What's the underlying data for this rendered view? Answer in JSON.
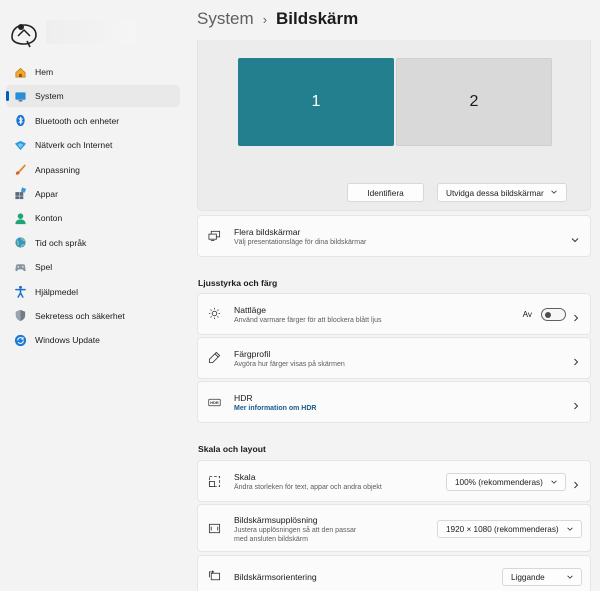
{
  "breadcrumb": {
    "parent": "System",
    "separator": "›",
    "current": "Bildskärm"
  },
  "sidebar": {
    "items": [
      {
        "label": "Hem",
        "icon": "home-icon",
        "active": false
      },
      {
        "label": "System",
        "icon": "system-icon",
        "active": true
      },
      {
        "label": "Bluetooth och enheter",
        "icon": "bluetooth-icon",
        "active": false
      },
      {
        "label": "Nätverk och Internet",
        "icon": "network-icon",
        "active": false
      },
      {
        "label": "Anpassning",
        "icon": "brush-icon",
        "active": false
      },
      {
        "label": "Appar",
        "icon": "apps-icon",
        "active": false
      },
      {
        "label": "Konton",
        "icon": "account-icon",
        "active": false
      },
      {
        "label": "Tid och språk",
        "icon": "globe-icon",
        "active": false
      },
      {
        "label": "Spel",
        "icon": "gamepad-icon",
        "active": false
      },
      {
        "label": "Hjälpmedel",
        "icon": "accessibility-icon",
        "active": false
      },
      {
        "label": "Sekretess och säkerhet",
        "icon": "shield-icon",
        "active": false
      },
      {
        "label": "Windows Update",
        "icon": "update-icon",
        "active": false
      }
    ]
  },
  "monitors": {
    "monitor1": "1",
    "monitor2": "2",
    "identify_label": "Identifiera",
    "extend_label": "Utvidga dessa bildskärmar"
  },
  "multiple_displays": {
    "title": "Flera bildskärmar",
    "subtitle": "Välj presentationsläge för dina bildskärmar"
  },
  "brightness_section": "Ljusstyrka och färg",
  "night_light": {
    "title": "Nattläge",
    "subtitle": "Använd varmare färger för att blockera blått ljus",
    "state_label": "Av",
    "on": false
  },
  "color_profile": {
    "title": "Färgprofil",
    "subtitle": "Avgöra hur färger visas på skärmen"
  },
  "hdr": {
    "title": "HDR",
    "link": "Mer information om HDR",
    "icon_text": "HDR"
  },
  "scale_section": "Skala och layout",
  "scale": {
    "title": "Skala",
    "subtitle": "Ändra storleken för text, appar och andra objekt",
    "value": "100% (rekommenderas)"
  },
  "resolution": {
    "title": "Bildskärmsupplösning",
    "subtitle_line1": "Justera upplösningen så att den passar",
    "subtitle_line2": "med ansluten bildskärm",
    "value": "1920 × 1080 (rekommenderas)"
  },
  "orientation": {
    "title": "Bildskärmsorientering",
    "value": "Liggande"
  },
  "colors": {
    "accent": "#005fb8",
    "monitor_primary": "#237e8e",
    "link": "#1a5a8c"
  }
}
